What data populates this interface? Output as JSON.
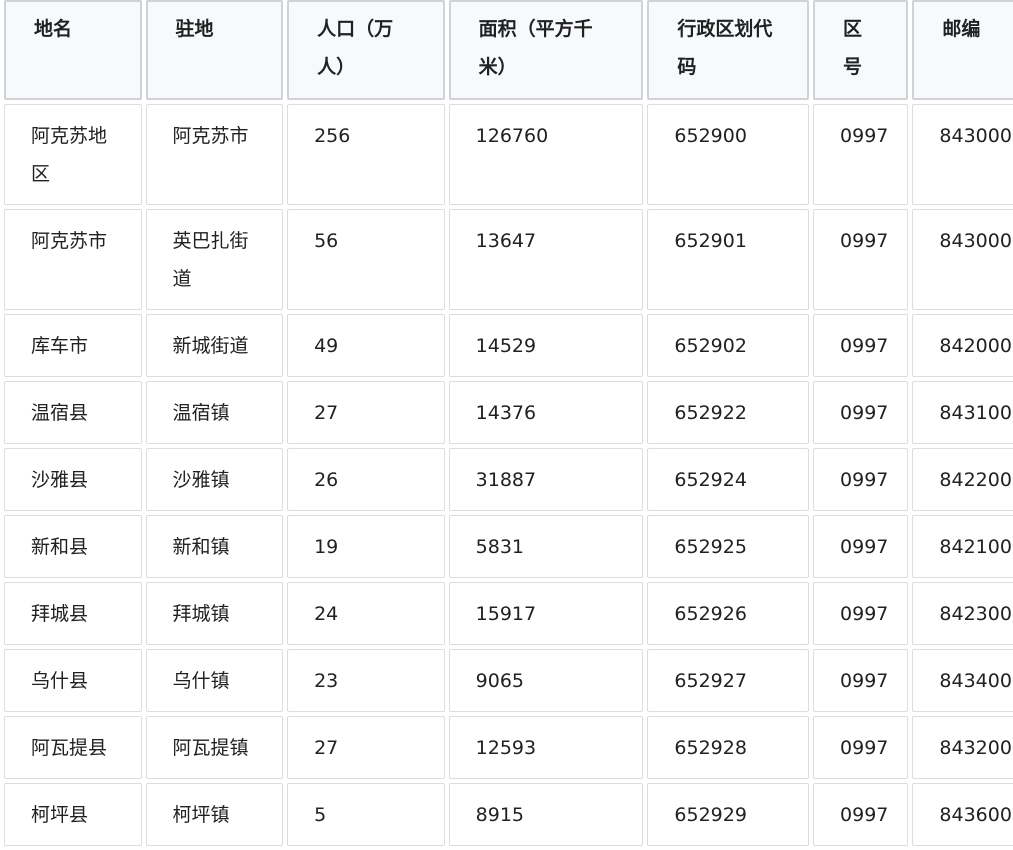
{
  "table": {
    "headers": [
      "地名",
      "驻地",
      "人口（万人）",
      "面积（平方千米）",
      "行政区划代码",
      "区号",
      "邮编"
    ],
    "rows": [
      [
        "阿克苏地区",
        "阿克苏市",
        "256",
        "126760",
        "652900",
        "0997",
        "843000"
      ],
      [
        "阿克苏市",
        "英巴扎街道",
        "56",
        "13647",
        "652901",
        "0997",
        "843000"
      ],
      [
        "库车市",
        "新城街道",
        "49",
        "14529",
        "652902",
        "0997",
        "842000"
      ],
      [
        "温宿县",
        "温宿镇",
        "27",
        "14376",
        "652922",
        "0997",
        "843100"
      ],
      [
        "沙雅县",
        "沙雅镇",
        "26",
        "31887",
        "652924",
        "0997",
        "842200"
      ],
      [
        "新和县",
        "新和镇",
        "19",
        "5831",
        "652925",
        "0997",
        "842100"
      ],
      [
        "拜城县",
        "拜城镇",
        "24",
        "15917",
        "652926",
        "0997",
        "842300"
      ],
      [
        "乌什县",
        "乌什镇",
        "23",
        "9065",
        "652927",
        "0997",
        "843400"
      ],
      [
        "阿瓦提县",
        "阿瓦提镇",
        "27",
        "12593",
        "652928",
        "0997",
        "843200"
      ],
      [
        "柯坪县",
        "柯坪镇",
        "5",
        "8915",
        "652929",
        "0997",
        "843600"
      ]
    ]
  }
}
